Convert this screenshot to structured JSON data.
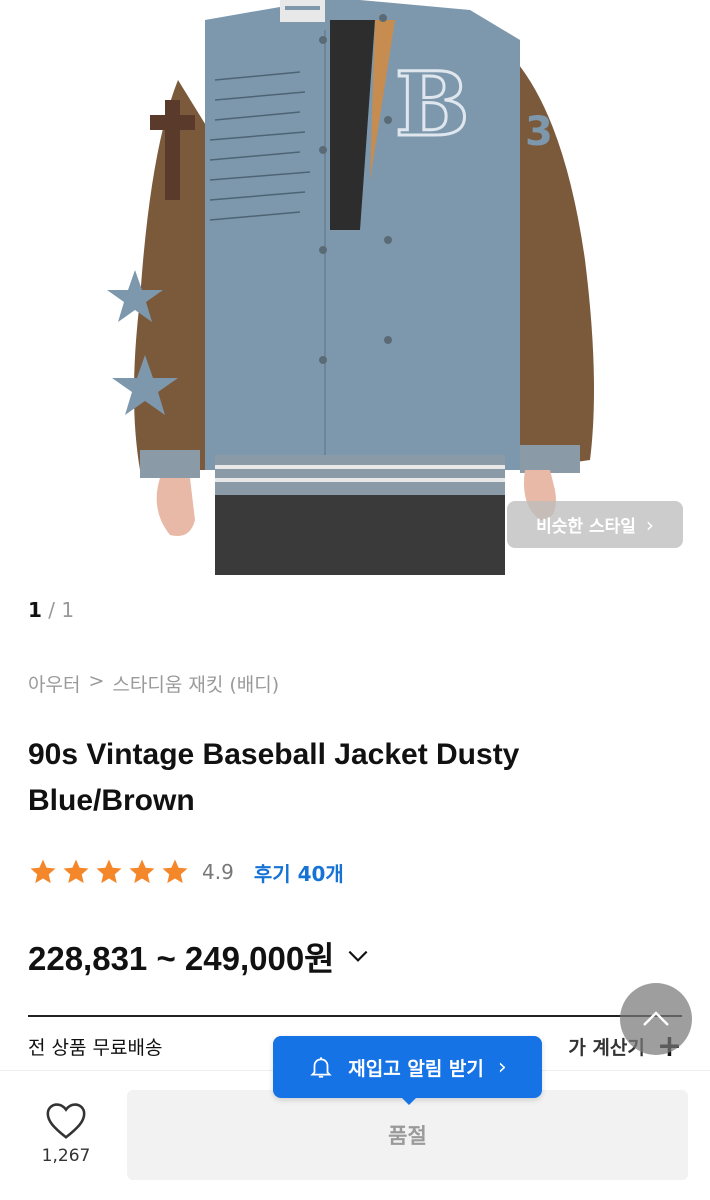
{
  "hero": {
    "similar_style_label": "비슷한 스타일",
    "pager_current": "1",
    "pager_separator": "/",
    "pager_total": "1"
  },
  "breadcrumb": {
    "category": "아우터",
    "separator": ">",
    "subcategory": "스타디움 재킷 (배디)"
  },
  "product": {
    "title": "90s Vintage Baseball Jacket Dusty Blue/Brown",
    "rating_stars": 5,
    "rating_value": "4.9",
    "reviews_label": "후기 40개",
    "price": "228,831 ~ 249,000원"
  },
  "shipping": {
    "free_label": "전 상품 무료배송",
    "calc_label": "가 계산기",
    "plus": "+"
  },
  "restock_label": "재입고 알림 받기",
  "bottom": {
    "like_count": "1,267",
    "soldout_label": "품절"
  },
  "colors": {
    "accent_blue": "#1673e6",
    "star": "#f5872b",
    "jacket_body": "#7d98ad",
    "jacket_sleeve": "#7b5a3c"
  },
  "icons": [
    "heart-icon",
    "bell-icon",
    "chevron-up-icon",
    "chevron-down-icon",
    "star-icon",
    "chevron-right-icon"
  ]
}
